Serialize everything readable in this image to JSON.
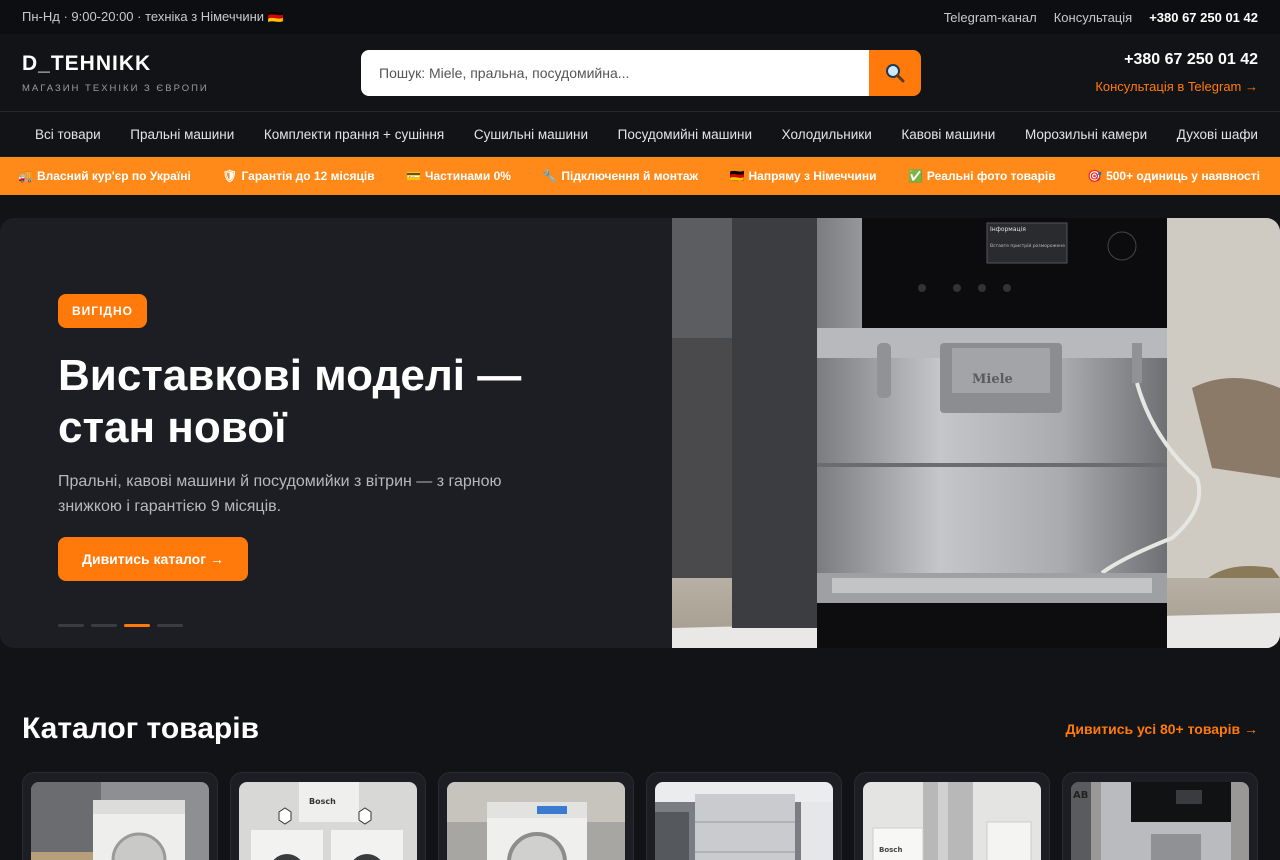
{
  "topbar": {
    "hours": "Пн-Нд · 9:00-20:00 · техніка з Німеччини 🇩🇪",
    "links": [
      "Telegram-канал",
      "Консультація"
    ],
    "phone": "+380 67 250 01 42"
  },
  "header": {
    "brand": "D_TEHNIKK",
    "tagline": "МАГАЗИН ТЕХНІКИ З ЄВРОПИ",
    "search_placeholder": "Пошук: Miele, пральна, посудомийна...",
    "phone": "+380 67 250 01 42",
    "telegram": "Консультація в Telegram →"
  },
  "nav": [
    "Всі товари",
    "Пральні машини",
    "Комплекти прання + сушіння",
    "Сушильні машини",
    "Посудомийні машини",
    "Холодильники",
    "Кавові машини",
    "Морозильні камери",
    "Духові шафи"
  ],
  "ribbon": [
    {
      "icon": "🚚",
      "label": "Власний кур'єр по Україні"
    },
    {
      "icon": "🛡",
      "label": "Гарантія до 12 місяців"
    },
    {
      "icon": "💳",
      "label": "Частинами 0%"
    },
    {
      "icon": "🔧",
      "label": "Підключення й монтаж"
    },
    {
      "icon": "🇩🇪",
      "label": "Напряму з Німеччини"
    },
    {
      "icon": "✅",
      "label": "Реальні фото товарів"
    },
    {
      "icon": "🎯",
      "label": "500+ одиниць у наявності"
    }
  ],
  "hero": {
    "badge": "ВИГІДНО",
    "title_line1": "Виставкові моделі —",
    "title_line2": "стан нової",
    "text": "Пральні, кавові машини й посудомийки з вітрин — з гарною знижкою і гарантією 9 місяців.",
    "cta": "Дивитись каталог →",
    "slides": 4,
    "active_slide": 3,
    "photo_brand": "Miele",
    "screen_title": "Інформація",
    "screen_text": "Вставте пристрій розморожене"
  },
  "catalog": {
    "title": "Каталог товарів",
    "all_link": "Дивитись усі 80+ товарів →",
    "cards": [
      {
        "name": "washer-miele"
      },
      {
        "name": "washer-bosch-set",
        "logo": "Bosch"
      },
      {
        "name": "washer-bosch"
      },
      {
        "name": "dishwasher-built-in"
      },
      {
        "name": "fridge-bosch",
        "logo": "Bosch"
      },
      {
        "name": "coffee-machine",
        "logo": "AB"
      }
    ]
  },
  "colors": {
    "accent": "#ff7a0a",
    "bg": "#121316",
    "panel": "#1d1e23"
  }
}
